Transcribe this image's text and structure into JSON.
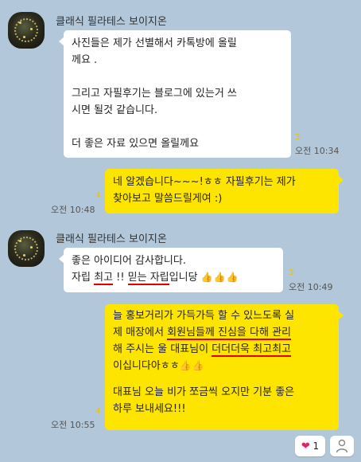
{
  "sender": {
    "name": "클래식 필라테스 보이지온"
  },
  "messages": [
    {
      "text": "사진들은 제가 선별해서 카톡방에 올릴\n께요 .\n\n그리고 자필후기는 블로그에 있는거 쓰\n시면 될것 같습니다.\n\n더 좋은 자료 있으면 올릴께요",
      "unread": "3",
      "time": "오전 10:34"
    },
    {
      "text": "네 알겠습니다~~~!ㅎㅎ 자필후기는 제가\n찾아보고 말씀드릴게여 :)",
      "unread": "4",
      "time": "오전 10:48"
    },
    {
      "line1": "좋은 아이디어 감사합니다.",
      "p1": "자립 ",
      "hl1": "최고",
      "p2": " !! ",
      "hl2": "믿는 자립",
      "p3": "입니당 ",
      "thumbs": "👍👍👍",
      "unread": "3",
      "time": "오전 10:49"
    },
    {
      "l1": "늘 홍보거리가 가득가득 할 수 있느도록 실",
      "l2a": "제 매장에서 ",
      "l2hl": "회원님들께 진심을 다해 관리",
      "l3a": "해 주시는 울 대표님이 ",
      "l3hl": "더더더욱 최고최고",
      "l4": "이십니다아ㅎㅎ",
      "l4thumbs": "👍👍",
      "l5": "대표님 오늘 비가 쪼금씩 오지만 기분 좋은",
      "l6": " 하루 보내세요!!!",
      "unread": "4",
      "time": "오전 10:55"
    }
  ],
  "reactions": {
    "like_count": "1"
  }
}
